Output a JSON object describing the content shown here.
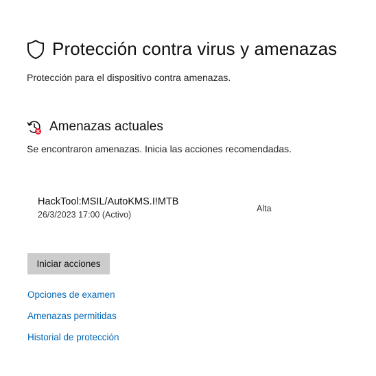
{
  "header": {
    "title": "Protección contra virus y amenazas",
    "icon": "shield-icon",
    "subtitle": "Protección para el dispositivo contra amenazas."
  },
  "current_threats": {
    "title": "Amenazas actuales",
    "icon": "history-alert-icon",
    "description": "Se encontraron amenazas. Inicia las acciones recomendadas.",
    "threats": [
      {
        "name": "HackTool:MSIL/AutoKMS.I!MTB",
        "date": "26/3/2023 17:00 (Activo)",
        "severity": "Alta"
      }
    ],
    "action_label": "Iniciar acciones"
  },
  "links": {
    "scan_options": "Opciones de examen",
    "allowed_threats": "Amenazas permitidas",
    "protection_history": "Historial de protección"
  },
  "colors": {
    "link": "#0067b8",
    "button_bg": "#cccccc",
    "alert_red": "#e81123"
  }
}
